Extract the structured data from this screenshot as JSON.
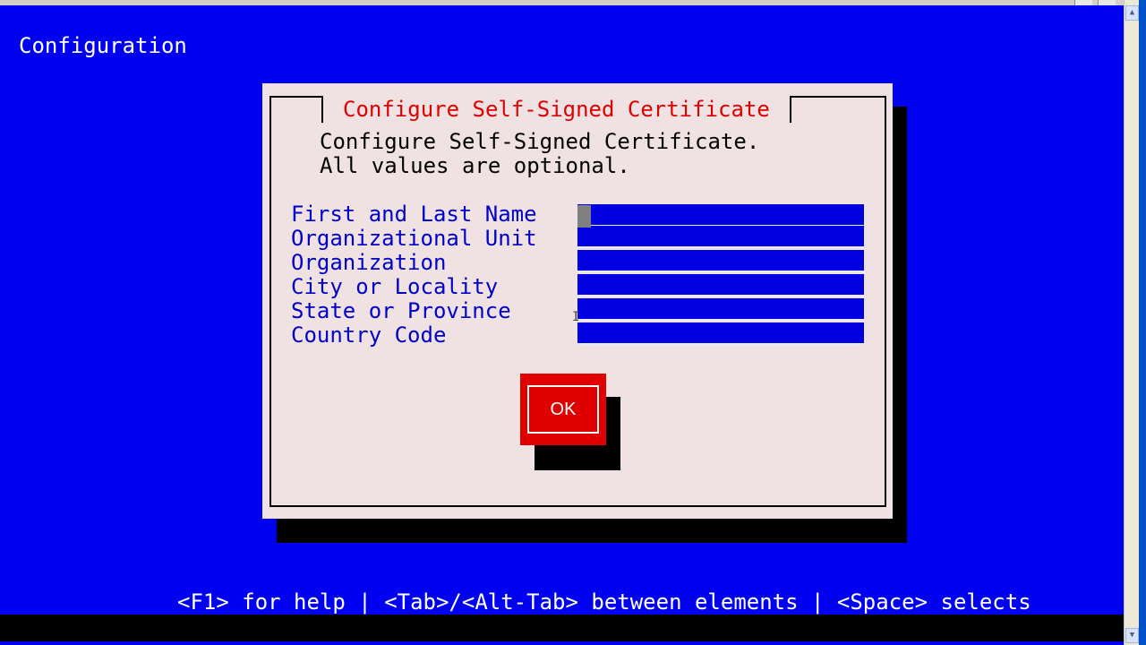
{
  "screen": {
    "title": "Configuration"
  },
  "dialog": {
    "title": "Configure Self-Signed Certificate",
    "intro_line1": "Configure Self-Signed Certificate.",
    "intro_line2": "All values are optional."
  },
  "form": {
    "fields": [
      {
        "label": "First and Last Name",
        "value": ""
      },
      {
        "label": "Organizational Unit",
        "value": ""
      },
      {
        "label": "Organization",
        "value": ""
      },
      {
        "label": "City or Locality",
        "value": ""
      },
      {
        "label": "State or Province",
        "value": ""
      },
      {
        "label": "Country Code",
        "value": ""
      }
    ]
  },
  "buttons": {
    "ok_label": "OK"
  },
  "help_bar": {
    "text": "<F1> for help | <Tab>/<Alt-Tab> between elements | <Space> selects"
  },
  "colors": {
    "background": "#0000f0",
    "dialog": "#f0e2e2",
    "title_red": "#e00000",
    "label_blue": "#0000c8",
    "input_blue": "#0000e0",
    "button_red": "#e00000"
  }
}
